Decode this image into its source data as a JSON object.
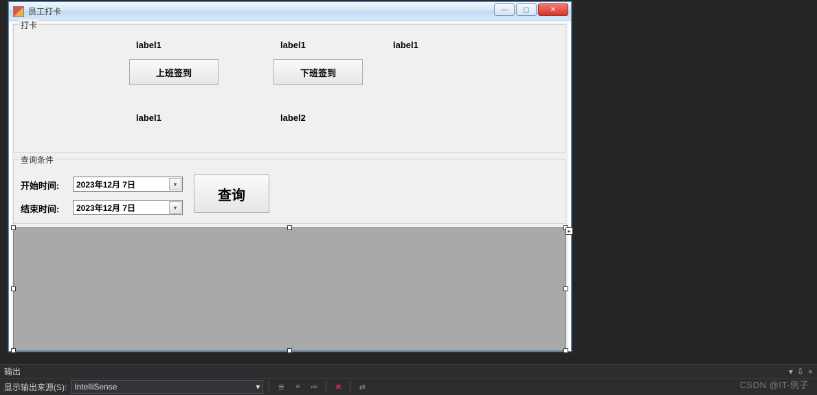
{
  "window": {
    "title": "员工打卡"
  },
  "groupbox_card": {
    "title": "打卡",
    "label_top1": "label1",
    "label_top2": "label1",
    "label_top3": "label1",
    "btn_checkin": "上班签到",
    "btn_checkout": "下班签到",
    "label_bottom1": "label1",
    "label_bottom2": "label2"
  },
  "groupbox_query": {
    "title": "查询条件",
    "start_label": "开始时间:",
    "end_label": "结束时间:",
    "start_date": "2023年12月  7日",
    "end_date": "2023年12月  7日",
    "query_btn": "查询"
  },
  "output_panel": {
    "title": "输出",
    "source_label": "显示输出来源(S):",
    "source_value": "IntelliSense",
    "pin_glyph": "📌",
    "dropdown_glyph": "▾"
  },
  "watermark": "CSDN @IT-例子"
}
